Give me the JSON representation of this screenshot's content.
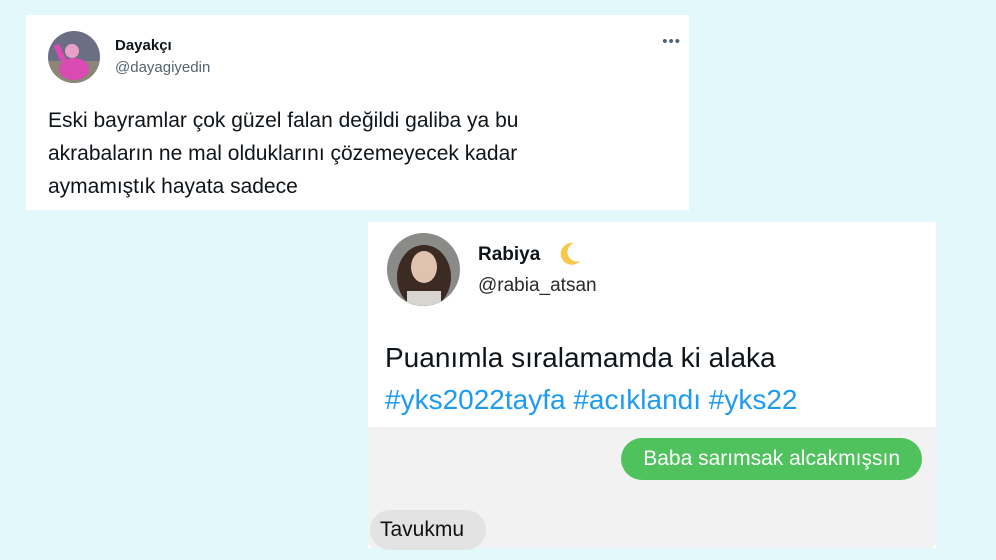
{
  "tweets": [
    {
      "name": "Dayakçı",
      "handle": "@dayagiyedin",
      "more_icon": "more-horizontal-icon",
      "text_lines": [
        "Eski bayramlar çok güzel falan değildi galiba ya bu",
        "akrabaların ne mal olduklarını çözemeyecek kadar",
        "aymamıştık hayata sadece"
      ]
    },
    {
      "name": "Rabiya",
      "name_emoji": "crescent-moon-icon",
      "handle": "@rabia_atsan",
      "text": "Puanımla sıralamamda ki alaka",
      "hashtags": [
        "#yks2022tayfa",
        "#acıklandı",
        "#yks22"
      ],
      "chat": {
        "outgoing": "Baba sarımsak alcakmışsın",
        "incoming": "Tavukmu"
      }
    }
  ],
  "colors": {
    "page_background": "#e2f8fa",
    "hashtag_blue": "#1d9bf0",
    "bubble_green": "#4fc25d",
    "bubble_gray": "#e3e3e3"
  }
}
